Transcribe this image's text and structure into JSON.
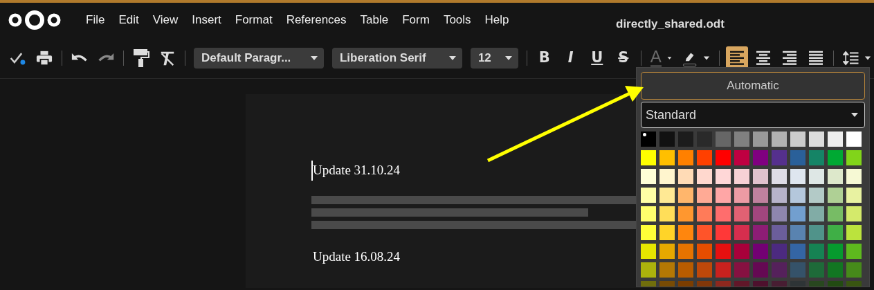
{
  "menu": [
    "File",
    "Edit",
    "View",
    "Insert",
    "Format",
    "References",
    "Table",
    "Form",
    "Tools",
    "Help"
  ],
  "window": {
    "title": "directly_shared.odt"
  },
  "toolbar": [
    {
      "kind": "save"
    },
    {
      "kind": "print"
    },
    {
      "kind": "separator"
    },
    {
      "kind": "undo"
    },
    {
      "kind": "redo",
      "disabled": true
    },
    {
      "kind": "separator"
    },
    {
      "kind": "clone-format"
    },
    {
      "kind": "clear-format"
    },
    {
      "kind": "separator"
    },
    {
      "kind": "dropdown",
      "value": "Default Paragr..."
    },
    {
      "kind": "dropdown",
      "value": "Liberation Serif"
    },
    {
      "kind": "dropdown",
      "value": "12"
    },
    {
      "kind": "separator"
    },
    {
      "kind": "bold",
      "label": "B"
    },
    {
      "kind": "italic",
      "label": "I"
    },
    {
      "kind": "underline",
      "label": "U"
    },
    {
      "kind": "strike",
      "label": "S"
    },
    {
      "kind": "separator"
    },
    {
      "kind": "font-color",
      "label": "A"
    },
    {
      "kind": "highlight"
    },
    {
      "kind": "separator"
    },
    {
      "kind": "align-left",
      "selected": true
    },
    {
      "kind": "align-center",
      "selected": false
    },
    {
      "kind": "align-right",
      "selected": false
    },
    {
      "kind": "justify",
      "selected": false
    },
    {
      "kind": "separator"
    },
    {
      "kind": "line-spacing"
    }
  ],
  "document": {
    "paragraphs": [
      {
        "kind": "text",
        "text": "Update 31.10.24",
        "cursor": true
      },
      {
        "kind": "redacted"
      },
      {
        "kind": "text",
        "text": "Update 16.08.24",
        "cursor": false
      }
    ]
  },
  "color_popup": {
    "automatic": "Automatic",
    "palette": "Standard",
    "swatches": [
      [
        {
          "color": "#000000",
          "selected": true
        },
        {
          "color": "#111111",
          "selected": false
        },
        {
          "color": "#1c1c1c",
          "selected": false
        },
        {
          "color": "#333333",
          "selected": false
        },
        {
          "color": "#666666",
          "selected": false
        },
        {
          "color": "#808080",
          "selected": false
        },
        {
          "color": "#999999",
          "selected": false
        },
        {
          "color": "#b2b2b2",
          "selected": false
        },
        {
          "color": "#cccccc",
          "selected": false
        },
        {
          "color": "#dddddd",
          "selected": false
        },
        {
          "color": "#eeeeee",
          "selected": false
        },
        {
          "color": "#ffffff",
          "selected": false
        }
      ],
      [
        {
          "color": "#ffff00",
          "selected": false
        },
        {
          "color": "#ffbf00",
          "selected": false
        },
        {
          "color": "#ff8000",
          "selected": false
        },
        {
          "color": "#ff4000",
          "selected": false
        },
        {
          "color": "#ff0000",
          "selected": false
        },
        {
          "color": "#bf0041",
          "selected": false
        },
        {
          "color": "#800080",
          "selected": false
        },
        {
          "color": "#55308d",
          "selected": false
        },
        {
          "color": "#2a6099",
          "selected": false
        },
        {
          "color": "#158466",
          "selected": false
        },
        {
          "color": "#00a933",
          "selected": false
        },
        {
          "color": "#81d41a",
          "selected": false
        }
      ],
      [
        {
          "color": "#ffffd7",
          "selected": false
        },
        {
          "color": "#fff5ce",
          "selected": false
        },
        {
          "color": "#ffdbb6",
          "selected": false
        },
        {
          "color": "#ffd8ce",
          "selected": false
        },
        {
          "color": "#ffd7d7",
          "selected": false
        },
        {
          "color": "#f7d1d5",
          "selected": false
        },
        {
          "color": "#e0c2cd",
          "selected": false
        },
        {
          "color": "#dedce6",
          "selected": false
        },
        {
          "color": "#dee6ef",
          "selected": false
        },
        {
          "color": "#dee7e5",
          "selected": false
        },
        {
          "color": "#dde8cb",
          "selected": false
        },
        {
          "color": "#f6f9d4",
          "selected": false
        }
      ],
      [
        {
          "color": "#ffffa6",
          "selected": false
        },
        {
          "color": "#ffe994",
          "selected": false
        },
        {
          "color": "#ffb66c",
          "selected": false
        },
        {
          "color": "#ffaa95",
          "selected": false
        },
        {
          "color": "#ffa6a6",
          "selected": false
        },
        {
          "color": "#ec9ba4",
          "selected": false
        },
        {
          "color": "#bf819e",
          "selected": false
        },
        {
          "color": "#b7b3ca",
          "selected": false
        },
        {
          "color": "#b4c7dc",
          "selected": false
        },
        {
          "color": "#b3cac7",
          "selected": false
        },
        {
          "color": "#afd095",
          "selected": false
        },
        {
          "color": "#e8f2a1",
          "selected": false
        }
      ],
      [
        {
          "color": "#ffff6d",
          "selected": false
        },
        {
          "color": "#ffde59",
          "selected": false
        },
        {
          "color": "#ff972f",
          "selected": false
        },
        {
          "color": "#ff7b59",
          "selected": false
        },
        {
          "color": "#ff6d6d",
          "selected": false
        },
        {
          "color": "#e16173",
          "selected": false
        },
        {
          "color": "#a1467e",
          "selected": false
        },
        {
          "color": "#8e86ae",
          "selected": false
        },
        {
          "color": "#729fcf",
          "selected": false
        },
        {
          "color": "#81aca6",
          "selected": false
        },
        {
          "color": "#77bc65",
          "selected": false
        },
        {
          "color": "#d4ea6b",
          "selected": false
        }
      ],
      [
        {
          "color": "#ffff38",
          "selected": false
        },
        {
          "color": "#ffd428",
          "selected": false
        },
        {
          "color": "#ff860d",
          "selected": false
        },
        {
          "color": "#ff5429",
          "selected": false
        },
        {
          "color": "#ff3838",
          "selected": false
        },
        {
          "color": "#d62e4e",
          "selected": false
        },
        {
          "color": "#8d1d75",
          "selected": false
        },
        {
          "color": "#6b5e9b",
          "selected": false
        },
        {
          "color": "#5983b0",
          "selected": false
        },
        {
          "color": "#50938a",
          "selected": false
        },
        {
          "color": "#3faf46",
          "selected": false
        },
        {
          "color": "#bbe33d",
          "selected": false
        }
      ],
      [
        {
          "color": "#e6e600",
          "selected": false
        },
        {
          "color": "#e6a800",
          "selected": false
        },
        {
          "color": "#e67300",
          "selected": false
        },
        {
          "color": "#e64d00",
          "selected": false
        },
        {
          "color": "#e61010",
          "selected": false
        },
        {
          "color": "#a8003a",
          "selected": false
        },
        {
          "color": "#730073",
          "selected": false
        },
        {
          "color": "#4c2a80",
          "selected": false
        },
        {
          "color": "#3465a4",
          "selected": false
        },
        {
          "color": "#168253",
          "selected": false
        },
        {
          "color": "#069a2e",
          "selected": false
        },
        {
          "color": "#5eb91e",
          "selected": false
        }
      ],
      [
        {
          "color": "#acb20c",
          "selected": false
        },
        {
          "color": "#b47804",
          "selected": false
        },
        {
          "color": "#b85c00",
          "selected": false
        },
        {
          "color": "#be480a",
          "selected": false
        },
        {
          "color": "#c9211e",
          "selected": false
        },
        {
          "color": "#861141",
          "selected": false
        },
        {
          "color": "#650953",
          "selected": false
        },
        {
          "color": "#55215b",
          "selected": false
        },
        {
          "color": "#355269",
          "selected": false
        },
        {
          "color": "#1e6a39",
          "selected": false
        },
        {
          "color": "#127622",
          "selected": false
        },
        {
          "color": "#468a1a",
          "selected": false
        }
      ],
      [
        {
          "color": "#706e0c",
          "selected": false
        },
        {
          "color": "#784b04",
          "selected": false
        },
        {
          "color": "#7b3d00",
          "selected": false
        },
        {
          "color": "#813709",
          "selected": false
        },
        {
          "color": "#8d281e",
          "selected": false
        },
        {
          "color": "#611729",
          "selected": false
        },
        {
          "color": "#4e102d",
          "selected": false
        },
        {
          "color": "#481d32",
          "selected": false
        },
        {
          "color": "#2e3436",
          "selected": false
        },
        {
          "color": "#28471f",
          "selected": false
        },
        {
          "color": "#224b12",
          "selected": false
        },
        {
          "color": "#395511",
          "selected": false
        }
      ]
    ]
  }
}
